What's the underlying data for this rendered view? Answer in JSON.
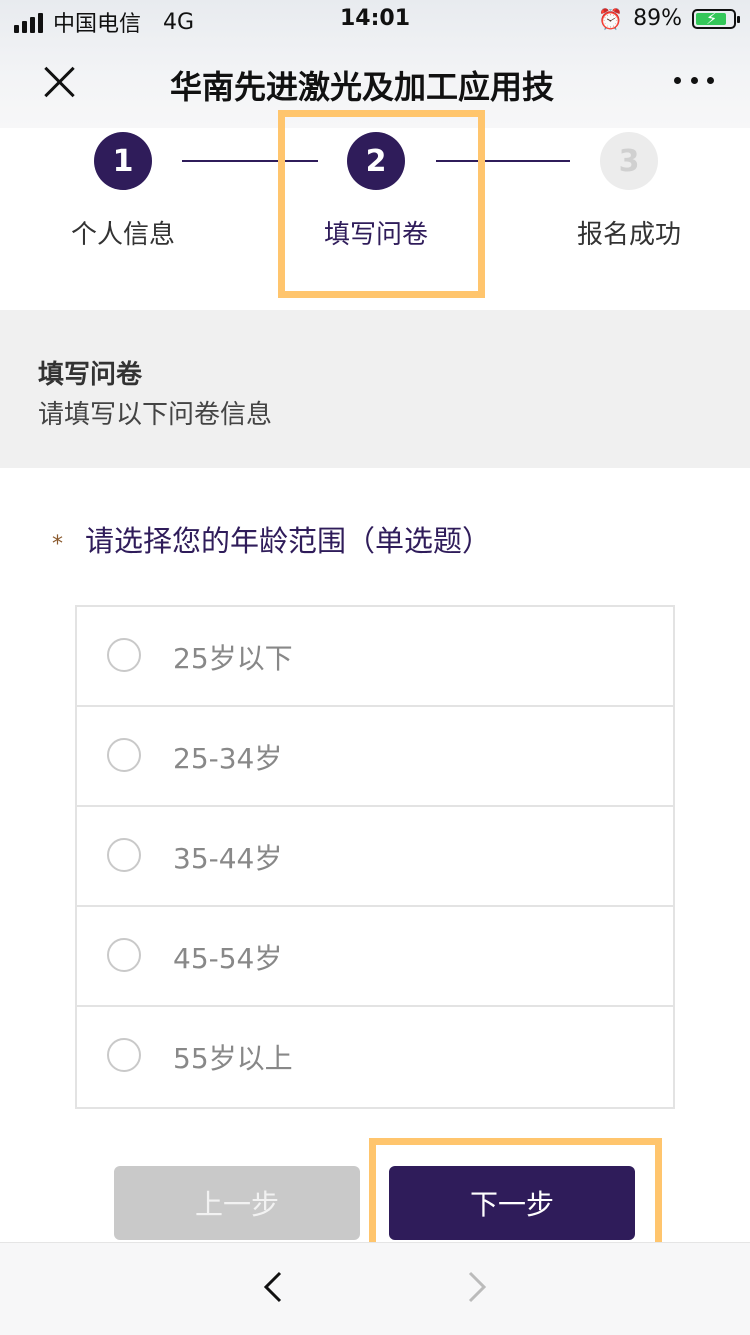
{
  "status_bar": {
    "carrier": "中国电信",
    "network": "4G",
    "time": "14:01",
    "battery_percent": "89%"
  },
  "nav": {
    "title": "华南先进激光及加工应用技"
  },
  "steps": [
    {
      "number": "1",
      "label": "个人信息",
      "state": "done"
    },
    {
      "number": "2",
      "label": "填写问卷",
      "state": "current"
    },
    {
      "number": "3",
      "label": "报名成功",
      "state": "pending"
    }
  ],
  "section": {
    "title": "填写问卷",
    "subtitle": "请填写以下问卷信息"
  },
  "question": {
    "required_mark": "*",
    "text": "请选择您的年龄范围（单选题）"
  },
  "options": [
    "25岁以下",
    "25-34岁",
    "35-44岁",
    "45-54岁",
    "55岁以上"
  ],
  "buttons": {
    "prev": "上一步",
    "next": "下一步"
  },
  "colors": {
    "accent": "#2f1c5a",
    "highlight": "#ffc56d",
    "disabled": "#c9c9c9",
    "battery": "#34c759"
  }
}
